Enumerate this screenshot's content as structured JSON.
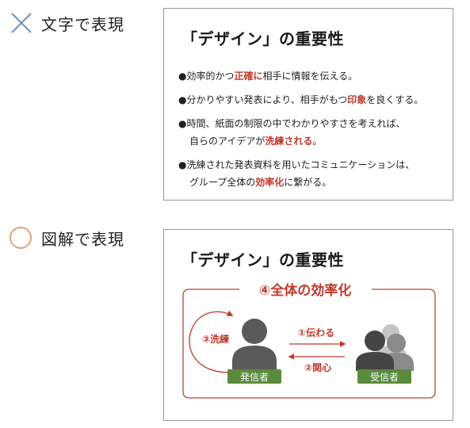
{
  "sections": {
    "text_version": {
      "label": "文字で表現",
      "marker_icon": "cross-mark-icon",
      "marker_color": "#6f95b8"
    },
    "diagram_version": {
      "label": "図解で表現",
      "marker_icon": "circle-mark-icon",
      "marker_color": "#e0a37a"
    }
  },
  "card_text": {
    "title": "「デザイン」の重要性",
    "bullets": [
      {
        "segments": [
          {
            "text": "●効率的かつ",
            "em": false
          },
          {
            "text": "正確に",
            "em": true
          },
          {
            "text": "相手に情報を伝える。",
            "em": false
          }
        ]
      },
      {
        "segments": [
          {
            "text": "●分かりやすい発表により、相手がもつ",
            "em": false
          },
          {
            "text": "印象",
            "em": true
          },
          {
            "text": "を良くする。",
            "em": false
          }
        ]
      },
      {
        "segments": [
          {
            "text": "●時間、紙面の制限の中でわかりやすさを考えれば、",
            "em": false
          }
        ],
        "continuation": [
          {
            "text": "自らのアイデアが",
            "em": false
          },
          {
            "text": "洗練される",
            "em": true
          },
          {
            "text": "。",
            "em": false
          }
        ]
      },
      {
        "segments": [
          {
            "text": "●洗練された発表資料を用いたコミュニケーションは、",
            "em": false
          }
        ],
        "continuation": [
          {
            "text": "グループ全体の",
            "em": false
          },
          {
            "text": "効率化",
            "em": true
          },
          {
            "text": "に繋がる。",
            "em": false
          }
        ]
      }
    ]
  },
  "card_diagram": {
    "title": "「デザイン」の重要性",
    "frame_label": "④全体の効率化",
    "loop_label": "③洗練",
    "forward_label": "①伝わる",
    "back_label": "②関心",
    "sender_label": "発信者",
    "receiver_label": "受信者",
    "colors": {
      "accent": "#c0392b",
      "frame": "#b5473a",
      "badge": "#5a8a3c",
      "person_dark": "#5a5a5a",
      "person_mid": "#8a8a8a",
      "person_light": "#c4c4c4"
    }
  }
}
